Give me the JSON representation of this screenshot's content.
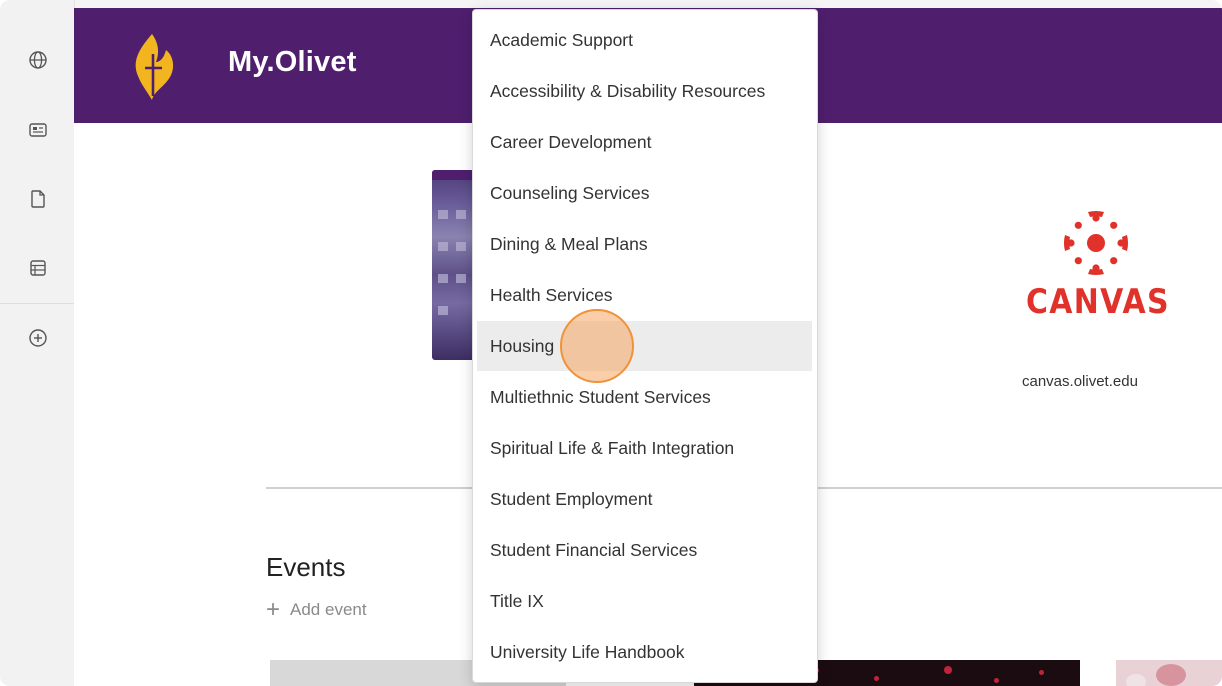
{
  "header": {
    "site_title": "My.Olivet"
  },
  "rail": {
    "items": [
      {
        "icon": "globe-icon"
      },
      {
        "icon": "news-icon"
      },
      {
        "icon": "page-icon"
      },
      {
        "icon": "list-icon"
      },
      {
        "icon": "add-circle-icon"
      }
    ]
  },
  "menu": {
    "items": [
      {
        "label": "Academic Support"
      },
      {
        "label": "Accessibility & Disability Resources"
      },
      {
        "label": "Career Development"
      },
      {
        "label": "Counseling Services"
      },
      {
        "label": "Dining & Meal Plans"
      },
      {
        "label": "Health Services"
      },
      {
        "label": "Housing",
        "hovered": true
      },
      {
        "label": "Multiethnic Student Services"
      },
      {
        "label": "Spiritual Life & Faith Integration"
      },
      {
        "label": "Student Employment"
      },
      {
        "label": "Student Financial Services"
      },
      {
        "label": "Title IX"
      },
      {
        "label": "University Life Handbook"
      }
    ]
  },
  "canvas_tile": {
    "logo_text": "CANVAS",
    "url": "canvas.olivet.edu"
  },
  "events": {
    "title": "Events",
    "add_label": "Add event"
  },
  "colors": {
    "header_bg": "#4f1f6e",
    "canvas_red": "#e0322a",
    "logo_gold": "#f2b51f",
    "cursor": "#f0923c"
  }
}
